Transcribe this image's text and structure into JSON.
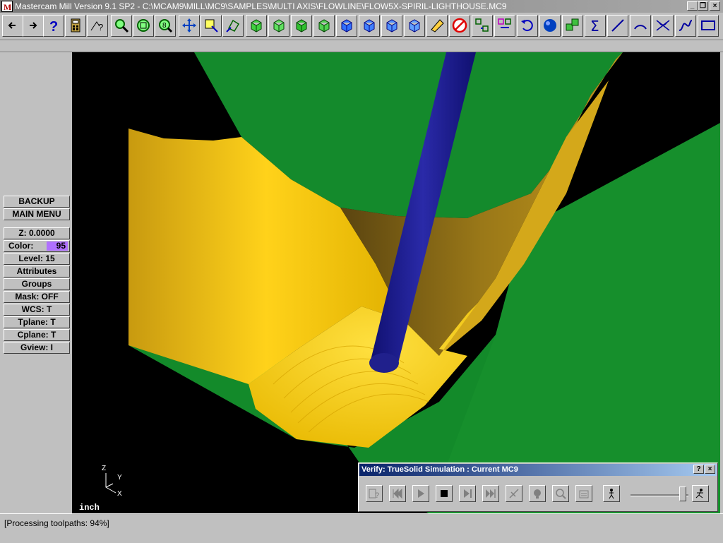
{
  "window": {
    "title": "Mastercam Mill Version 9.1 SP2 - C:\\MCAM9\\MILL\\MC9\\SAMPLES\\MULTI AXIS\\FLOWLINE\\FLOW5X-SPIRIL-LIGHTHOUSE.MC9",
    "minimize_label": "_",
    "restore_label": "❐",
    "close_label": "×"
  },
  "toolbar": {
    "buttons": [
      "back-arrow-icon",
      "forward-arrow-icon",
      "help-icon",
      "calculator-icon",
      "analyze-icon",
      "zoom-icon",
      "unzoom-icon",
      "zoom-window-icon",
      "pan-icon",
      "select-icon",
      "dynamic-rotate-icon",
      "view-top-icon",
      "view-front-icon",
      "view-side-icon",
      "view-iso-icon",
      "cube-1-icon",
      "cube-2-icon",
      "cube-3-icon",
      "cube-4-icon",
      "erase-icon",
      "no-entry-icon",
      "translate-icon",
      "mirror-icon",
      "undo-icon",
      "sphere-icon",
      "transform-icon",
      "sum-icon",
      "line-icon",
      "arc-icon",
      "fillet-icon",
      "spline-icon",
      "rectangle-icon"
    ]
  },
  "menu": {
    "backup": "BACKUP",
    "main_menu": "MAIN MENU",
    "z": "Z:  0.0000",
    "color_label": "Color:",
    "color_value": "95",
    "level": "Level: 15",
    "attributes": "Attributes",
    "groups": "Groups",
    "mask": "Mask:  OFF",
    "wcs": "WCS:   T",
    "tplane": "Tplane:  T",
    "cplane": "Cplane:  T",
    "gview": "Gview:   I"
  },
  "viewport": {
    "units": "inch",
    "axis_z": "Z",
    "axis_y": "Y",
    "axis_x": "X"
  },
  "verify": {
    "title": "Verify: TrueSolid Simulation : Current MC9",
    "help_label": "?",
    "close_label": "×",
    "speed_fraction": 0.9
  },
  "status": {
    "text": "[Processing toolpaths:   94%]"
  }
}
